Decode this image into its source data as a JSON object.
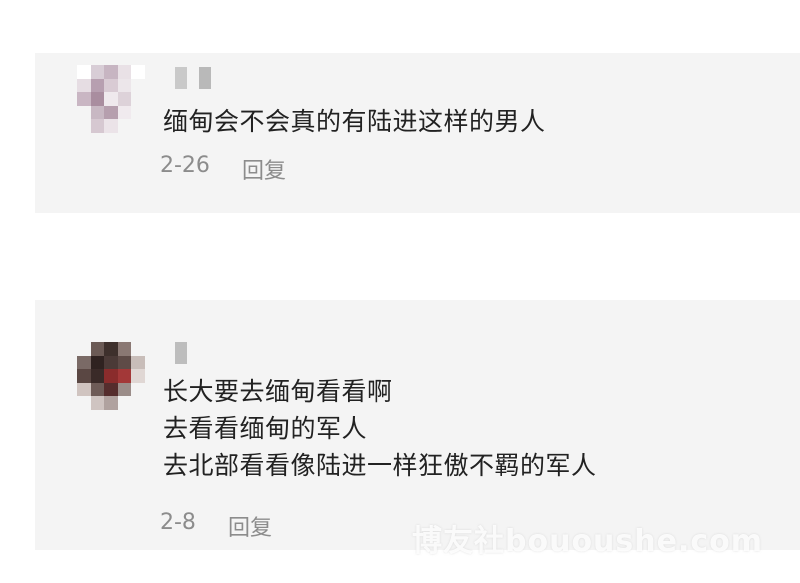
{
  "comments": [
    {
      "lines": [
        "缅甸会不会真的有陆进这样的男人"
      ],
      "date": "2-26",
      "reply_label": "回复"
    },
    {
      "lines": [
        "长大要去缅甸看看啊",
        "去看看缅甸的军人",
        "去北部看看像陆进一样狂傲不羁的军人"
      ],
      "date": "2-8",
      "reply_label": "回复"
    }
  ],
  "watermark": "博友社bououshe.com",
  "colors": {
    "card_bg": "#f4f4f4",
    "meta_text": "#8c8c8c",
    "body_text": "#222222"
  }
}
